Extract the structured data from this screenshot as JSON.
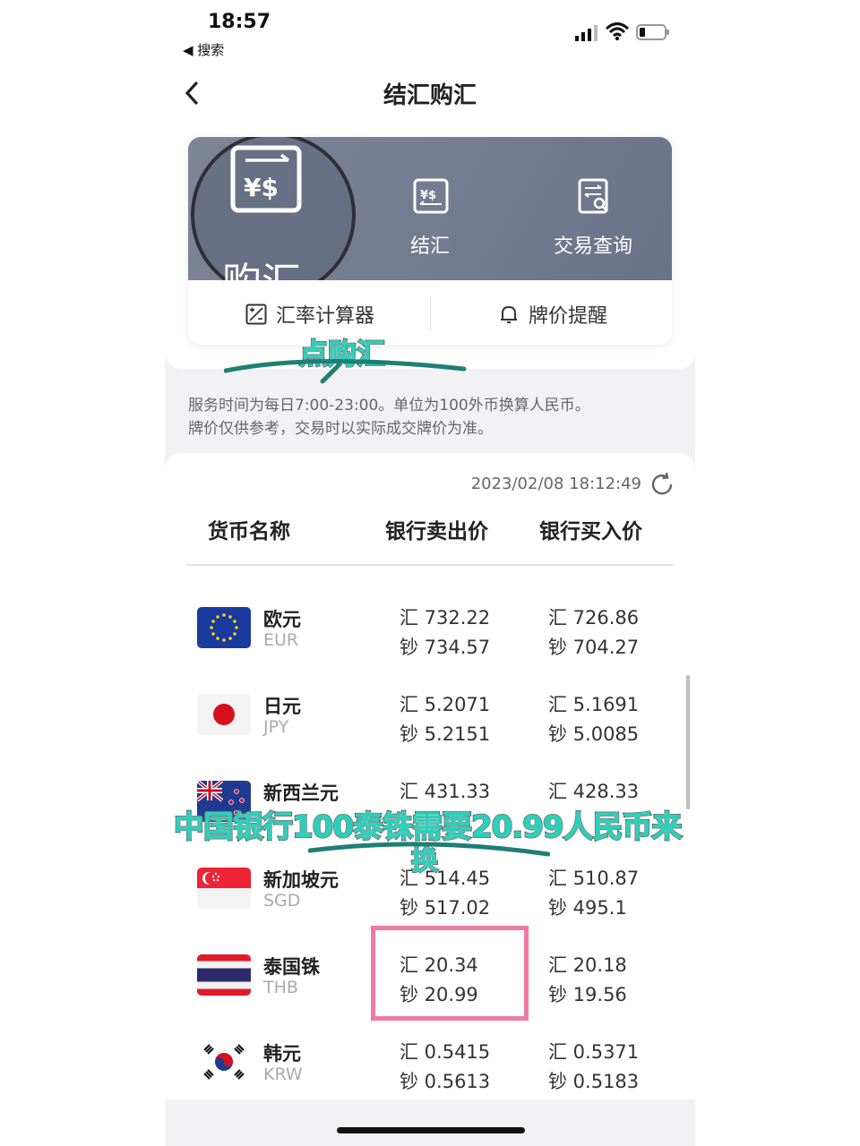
{
  "status": {
    "time": "18:57",
    "back_app": "◀ 搜索"
  },
  "nav": {
    "title": "结汇购汇"
  },
  "card": {
    "actions": [
      {
        "label": "购汇",
        "icon": "buy-currency-icon"
      },
      {
        "label": "结汇",
        "icon": "settle-currency-icon"
      },
      {
        "label": "交易查询",
        "icon": "transaction-search-icon"
      }
    ],
    "tools": [
      {
        "label": "汇率计算器",
        "icon": "calculator-icon"
      },
      {
        "label": "牌价提醒",
        "icon": "bell-icon"
      }
    ]
  },
  "annotations": {
    "tap_buy": "点购汇",
    "thb_note_line1": "中国银行100泰铢需要20.99人民币来",
    "thb_note_line2": "换"
  },
  "notice": {
    "line1": "服务时间为每日7:00-23:00。单位为100外币换算人民币。",
    "line2": "牌价仅供参考，交易时以实际成交牌价为准。"
  },
  "rates": {
    "timestamp": "2023/02/08 18:12:49",
    "headers": {
      "name": "货币名称",
      "sell": "银行卖出价",
      "buy": "银行买入价"
    },
    "rows": [
      {
        "name": "欧元",
        "code": "EUR",
        "flag": "eu-flag",
        "sell_transfer": "汇 732.22",
        "sell_cash": "钞 734.57",
        "buy_transfer": "汇 726.86",
        "buy_cash": "钞 704.27"
      },
      {
        "name": "日元",
        "code": "JPY",
        "flag": "japan-flag",
        "sell_transfer": "汇 5.2071",
        "sell_cash": "钞 5.2151",
        "buy_transfer": "汇 5.1691",
        "buy_cash": "钞 5.0085"
      },
      {
        "name": "新西兰元",
        "code": "",
        "flag": "new-zealand-flag",
        "sell_transfer": "汇 431.33",
        "sell_cash": "",
        "buy_transfer": "汇 428.33",
        "buy_cash": ""
      },
      {
        "name": "新加坡元",
        "code": "SGD",
        "flag": "singapore-flag",
        "sell_transfer": "汇 514.45",
        "sell_cash": "钞 517.02",
        "buy_transfer": "汇 510.87",
        "buy_cash": "钞 495.1"
      },
      {
        "name": "泰国铢",
        "code": "THB",
        "flag": "thailand-flag",
        "sell_transfer": "汇 20.34",
        "sell_cash": "钞 20.99",
        "buy_transfer": "汇 20.18",
        "buy_cash": "钞 19.56"
      },
      {
        "name": "韩元",
        "code": "KRW",
        "flag": "south-korea-flag",
        "sell_transfer": "汇 0.5415",
        "sell_cash": "钞 0.5613",
        "buy_transfer": "汇 0.5371",
        "buy_cash": "钞 0.5183"
      }
    ]
  },
  "colors": {
    "card_head": "#737b8f",
    "highlight": "#f07aa5",
    "annotation": "#2ad0bb"
  }
}
